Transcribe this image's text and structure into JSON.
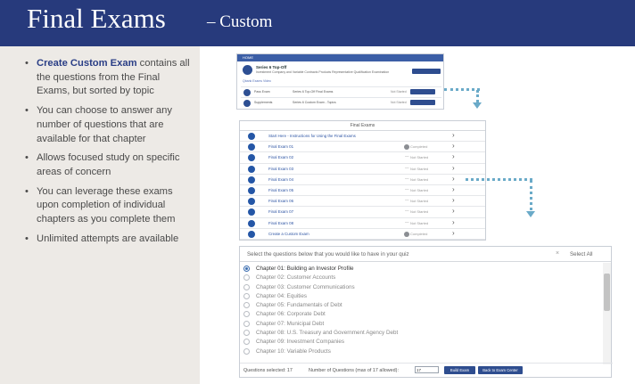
{
  "header": {
    "title": "Final Exams",
    "subtitle": "– Custom"
  },
  "bullets": {
    "b1_strong": "Create Custom Exam",
    "b1_rest": " contains all the questions from the Final Exams, but sorted by topic",
    "b2": "You can choose to answer any number of questions that are available for that chapter",
    "b3": "Allows focused study on specific areas of concern",
    "b4": "You can leverage these exams upon completion of individual chapters as you complete them",
    "b5": "Unlimited attempts are available"
  },
  "panel1": {
    "bar_label": "HOME",
    "product_title": "Series 6 Top-Off",
    "product_sub": "Investment Company and Variable Contracts Products Representative Qualification Examination",
    "links": "Qbank   Exams   Video",
    "rows": [
      {
        "name": "Pass Exam",
        "desc": "Series 6 Top-Off Final Exams",
        "status": "Not Started"
      },
      {
        "name": "Supplements",
        "desc": "Series 6 Custom Exam - Topics",
        "status": "Not Started"
      }
    ]
  },
  "panel2": {
    "header": "Final Exams",
    "rows": [
      {
        "label": "Start Here - Instructions for Using the Final Exams",
        "status": "",
        "marker": "none"
      },
      {
        "label": "Final Exam 01",
        "status": "Completed",
        "marker": "dot"
      },
      {
        "label": "Final Exam 02",
        "status": "Not Started",
        "marker": "dash"
      },
      {
        "label": "Final Exam 03",
        "status": "Not Started",
        "marker": "dash"
      },
      {
        "label": "Final Exam 04",
        "status": "Not Started",
        "marker": "dash"
      },
      {
        "label": "Final Exam 05",
        "status": "Not Started",
        "marker": "dash"
      },
      {
        "label": "Final Exam 06",
        "status": "Not Started",
        "marker": "dash"
      },
      {
        "label": "Final Exam 07",
        "status": "Not Started",
        "marker": "dash"
      },
      {
        "label": "Final Exam 08",
        "status": "Not Started",
        "marker": "dash"
      },
      {
        "label": "Create a Custom Exam",
        "status": "Completed",
        "marker": "dot"
      }
    ]
  },
  "panel3": {
    "instruction": "Select the questions below that you would like to have in your quiz",
    "clear": "×",
    "select_all": "Select All",
    "chapters": [
      {
        "label": "Chapter 01: Building an Investor Profile",
        "selected": true
      },
      {
        "label": "Chapter 02: Customer Accounts",
        "selected": false
      },
      {
        "label": "Chapter 03: Customer Communications",
        "selected": false
      },
      {
        "label": "Chapter 04: Equities",
        "selected": false
      },
      {
        "label": "Chapter 05: Fundamentals of Debt",
        "selected": false
      },
      {
        "label": "Chapter 06: Corporate Debt",
        "selected": false
      },
      {
        "label": "Chapter 07: Municipal Debt",
        "selected": false
      },
      {
        "label": "Chapter 08: U.S. Treasury and Government Agency Debt",
        "selected": false
      },
      {
        "label": "Chapter 09: Investment Companies",
        "selected": false
      },
      {
        "label": "Chapter 10: Variable Products",
        "selected": false
      }
    ],
    "questions_selected": "Questions selected: 17",
    "number_label": "Number of Questions (max of 17 allowed):",
    "number_value": "17",
    "build_button": "Build Exam",
    "back_button": "Back to Exam Center"
  },
  "colors": {
    "header_bg": "#273a7c",
    "sidebar_bg": "#edeae6",
    "accent": "#2e4d8f",
    "connector": "#6aaac8"
  }
}
